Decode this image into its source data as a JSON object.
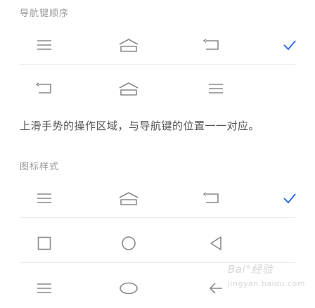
{
  "section_nav_order": {
    "title": "导航键顺序"
  },
  "description": "上滑手势的操作区域，与导航键的位置一一对应。",
  "section_icon_style": {
    "title": "图标样式"
  },
  "watermark": {
    "brand": "Bai",
    "brand_tail": "经验",
    "sub": "jingyan.baidu.com"
  },
  "colors": {
    "accent": "#2f6fe5",
    "icon": "#8a8a8a",
    "divider": "#ececec",
    "muted": "#9a9a9a"
  },
  "nav_order_options": [
    {
      "icons": [
        "menu-lines",
        "home-arch",
        "back-arrow-bracket"
      ],
      "selected": true
    },
    {
      "icons": [
        "back-arrow-bracket",
        "home-arch",
        "menu-lines"
      ],
      "selected": false
    }
  ],
  "icon_style_options": [
    {
      "icons": [
        "menu-lines",
        "home-arch",
        "back-arrow-bracket"
      ],
      "selected": true
    },
    {
      "icons": [
        "square",
        "circle",
        "triangle-left"
      ],
      "selected": false
    },
    {
      "icons": [
        "menu-lines",
        "oval",
        "arrow-left"
      ],
      "selected": false
    }
  ]
}
